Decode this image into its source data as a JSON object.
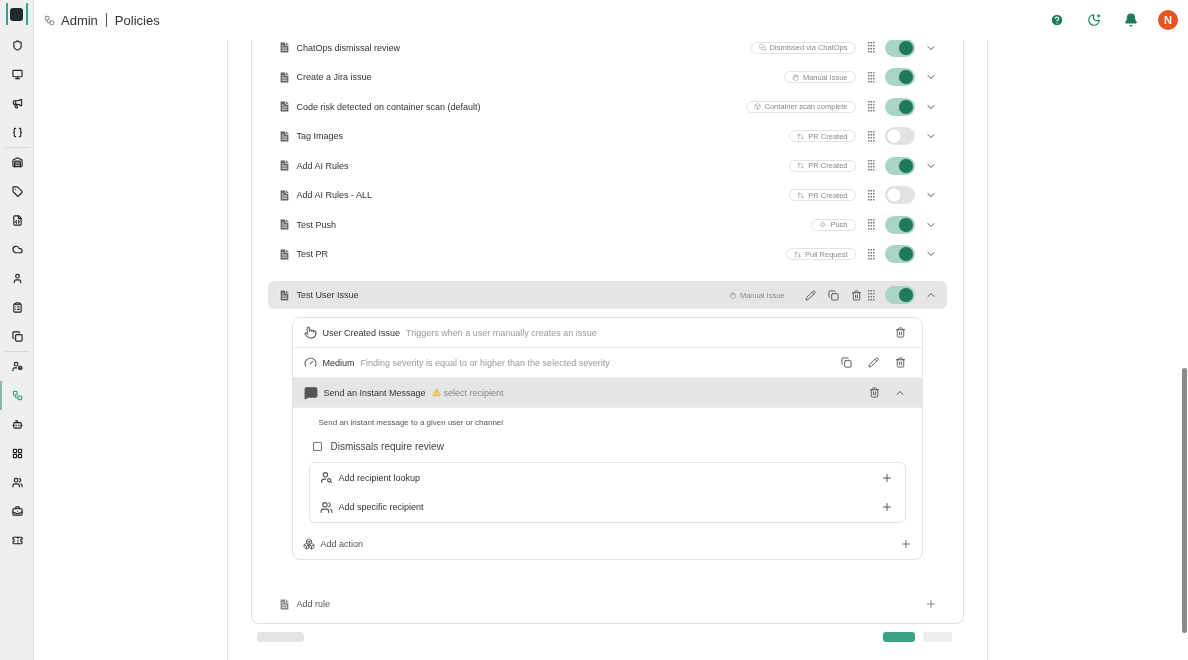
{
  "header": {
    "section": "Admin",
    "page": "Policies",
    "avatar": "N"
  },
  "sidebar": {
    "groups": [
      [
        {
          "selected": false
        },
        {
          "selected": false
        },
        {
          "selected": false
        },
        {
          "selected": false
        }
      ],
      [
        {
          "selected": false
        },
        {
          "selected": false
        },
        {
          "selected": false
        },
        {
          "selected": false
        },
        {
          "selected": false
        },
        {
          "selected": false
        },
        {
          "selected": false
        }
      ],
      [
        {
          "selected": false
        },
        {
          "selected": true
        },
        {
          "selected": false
        },
        {
          "selected": false
        },
        {
          "selected": false
        },
        {
          "selected": false
        },
        {
          "selected": false
        }
      ]
    ]
  },
  "rules": [
    {
      "name": "ChatOps dismissal review",
      "trigger": {
        "kind": "chatops",
        "label": "Dismissed via ChatOps"
      },
      "enabled": true,
      "expanded": false
    },
    {
      "name": "Create a Jira issue",
      "trigger": {
        "kind": "manual",
        "label": "Manual Issue"
      },
      "enabled": true,
      "expanded": false
    },
    {
      "name": "Code risk detected on container scan (default)",
      "trigger": {
        "kind": "container",
        "label": "Container scan complete"
      },
      "enabled": true,
      "expanded": false
    },
    {
      "name": "Tag Images",
      "trigger": {
        "kind": "pr",
        "label": "PR Created"
      },
      "enabled": false,
      "expanded": false
    },
    {
      "name": "Add AI Rules",
      "trigger": {
        "kind": "pr",
        "label": "PR Created"
      },
      "enabled": true,
      "expanded": false
    },
    {
      "name": "Add AI Rules - ALL",
      "trigger": {
        "kind": "pr",
        "label": "PR Created"
      },
      "enabled": false,
      "expanded": false
    },
    {
      "name": "Test Push",
      "trigger": {
        "kind": "push",
        "label": "Push"
      },
      "enabled": true,
      "expanded": false
    },
    {
      "name": "Test PR",
      "trigger": {
        "kind": "pull_request",
        "label": "Pull Request"
      },
      "enabled": true,
      "expanded": false
    },
    {
      "name": "Test User Issue",
      "trigger": {
        "kind": "manual",
        "label": "Manual Issue"
      },
      "enabled": true,
      "expanded": true
    }
  ],
  "detail": {
    "steps": [
      {
        "kind": "trigger",
        "title": "User Created Issue",
        "description": "Triggers when a user manually creates an issue"
      },
      {
        "kind": "condition",
        "title": "Medium",
        "description": "Finding severity is equal to or higher than the selected severity"
      }
    ],
    "action": {
      "title": "Send an Instant Message",
      "warning": "select recipient",
      "expanded": true,
      "description": "Send an instant message to a given user or channel",
      "checkbox": {
        "label": "Dismissals require review",
        "checked": false
      },
      "recipients": [
        {
          "kind": "lookup",
          "label": "Add recipient lookup"
        },
        {
          "kind": "specific",
          "label": "Add specific recipient"
        }
      ]
    },
    "add_action": "Add action"
  },
  "add_rule": "Add rule"
}
